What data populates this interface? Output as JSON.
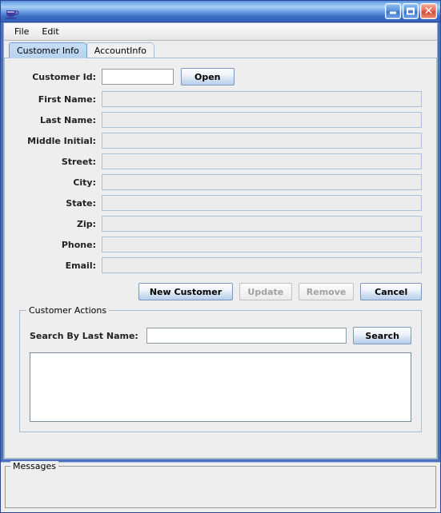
{
  "window": {
    "title": "",
    "icon": "java-coffee-cup-icon",
    "controls": {
      "minimize_label": "Minimize",
      "maximize_label": "Maximize",
      "close_label": "Close"
    },
    "accent_color": "#3361bb",
    "close_color": "#d24a33",
    "panel_color": "#eeeeee"
  },
  "menubar": {
    "items": [
      {
        "label": "File"
      },
      {
        "label": "Edit"
      }
    ]
  },
  "tabs": [
    {
      "label": "Customer Info",
      "selected": true
    },
    {
      "label": "AccountInfo",
      "selected": false
    }
  ],
  "form": {
    "fields": [
      {
        "label": "Customer Id:",
        "value": "",
        "enabled": true,
        "editable": true
      },
      {
        "label": "First Name:",
        "value": "",
        "enabled": false,
        "editable": false
      },
      {
        "label": "Last Name:",
        "value": "",
        "enabled": false,
        "editable": false
      },
      {
        "label": "Middle Initial:",
        "value": "",
        "enabled": false,
        "editable": false
      },
      {
        "label": "Street:",
        "value": "",
        "enabled": false,
        "editable": false
      },
      {
        "label": "City:",
        "value": "",
        "enabled": false,
        "editable": false
      },
      {
        "label": "State:",
        "value": "",
        "enabled": false,
        "editable": false
      },
      {
        "label": "Zip:",
        "value": "",
        "enabled": false,
        "editable": false
      },
      {
        "label": "Phone:",
        "value": "",
        "enabled": false,
        "editable": false
      },
      {
        "label": "Email:",
        "value": "",
        "enabled": false,
        "editable": false
      }
    ],
    "open_button": {
      "label": "Open",
      "enabled": true
    }
  },
  "actions": [
    {
      "label": "New Customer",
      "enabled": true
    },
    {
      "label": "Update",
      "enabled": false
    },
    {
      "label": "Remove",
      "enabled": false
    },
    {
      "label": "Cancel",
      "enabled": true
    }
  ],
  "customer_actions": {
    "title": "Customer Actions",
    "search_label": "Search By Last Name:",
    "search_value": "",
    "search_button": "Search",
    "results": []
  },
  "messages": {
    "title": "Messages",
    "text": ""
  }
}
